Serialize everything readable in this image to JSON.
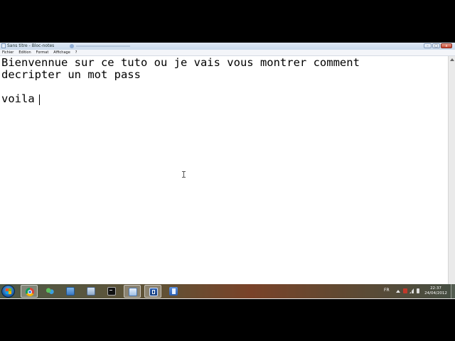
{
  "window": {
    "title": "Sans titre - Bloc-notes",
    "controls": {
      "minimize": "–",
      "maximize": "□",
      "close": "x"
    }
  },
  "menu": {
    "items": [
      "Fichier",
      "Edition",
      "Format",
      "Affichage",
      "?"
    ]
  },
  "editor": {
    "lines": [
      "Bienvennue sur ce tuto ou je vais vous montrer comment",
      "decripter un mot pass",
      "",
      "voila"
    ]
  },
  "taskbar": {
    "buttons": [
      {
        "icon": "chrome-icon",
        "active": true
      },
      {
        "icon": "people-icon",
        "active": false
      },
      {
        "icon": "folder-icon",
        "active": false
      },
      {
        "icon": "window-icon",
        "active": false
      },
      {
        "icon": "cmd-icon",
        "active": false
      },
      {
        "icon": "notepad-icon",
        "active": true
      },
      {
        "icon": "pen-icon",
        "active": true
      },
      {
        "icon": "document-icon",
        "active": false
      }
    ],
    "tray": {
      "language": "FR",
      "time": "22:37",
      "date": "24/04/2012"
    }
  }
}
